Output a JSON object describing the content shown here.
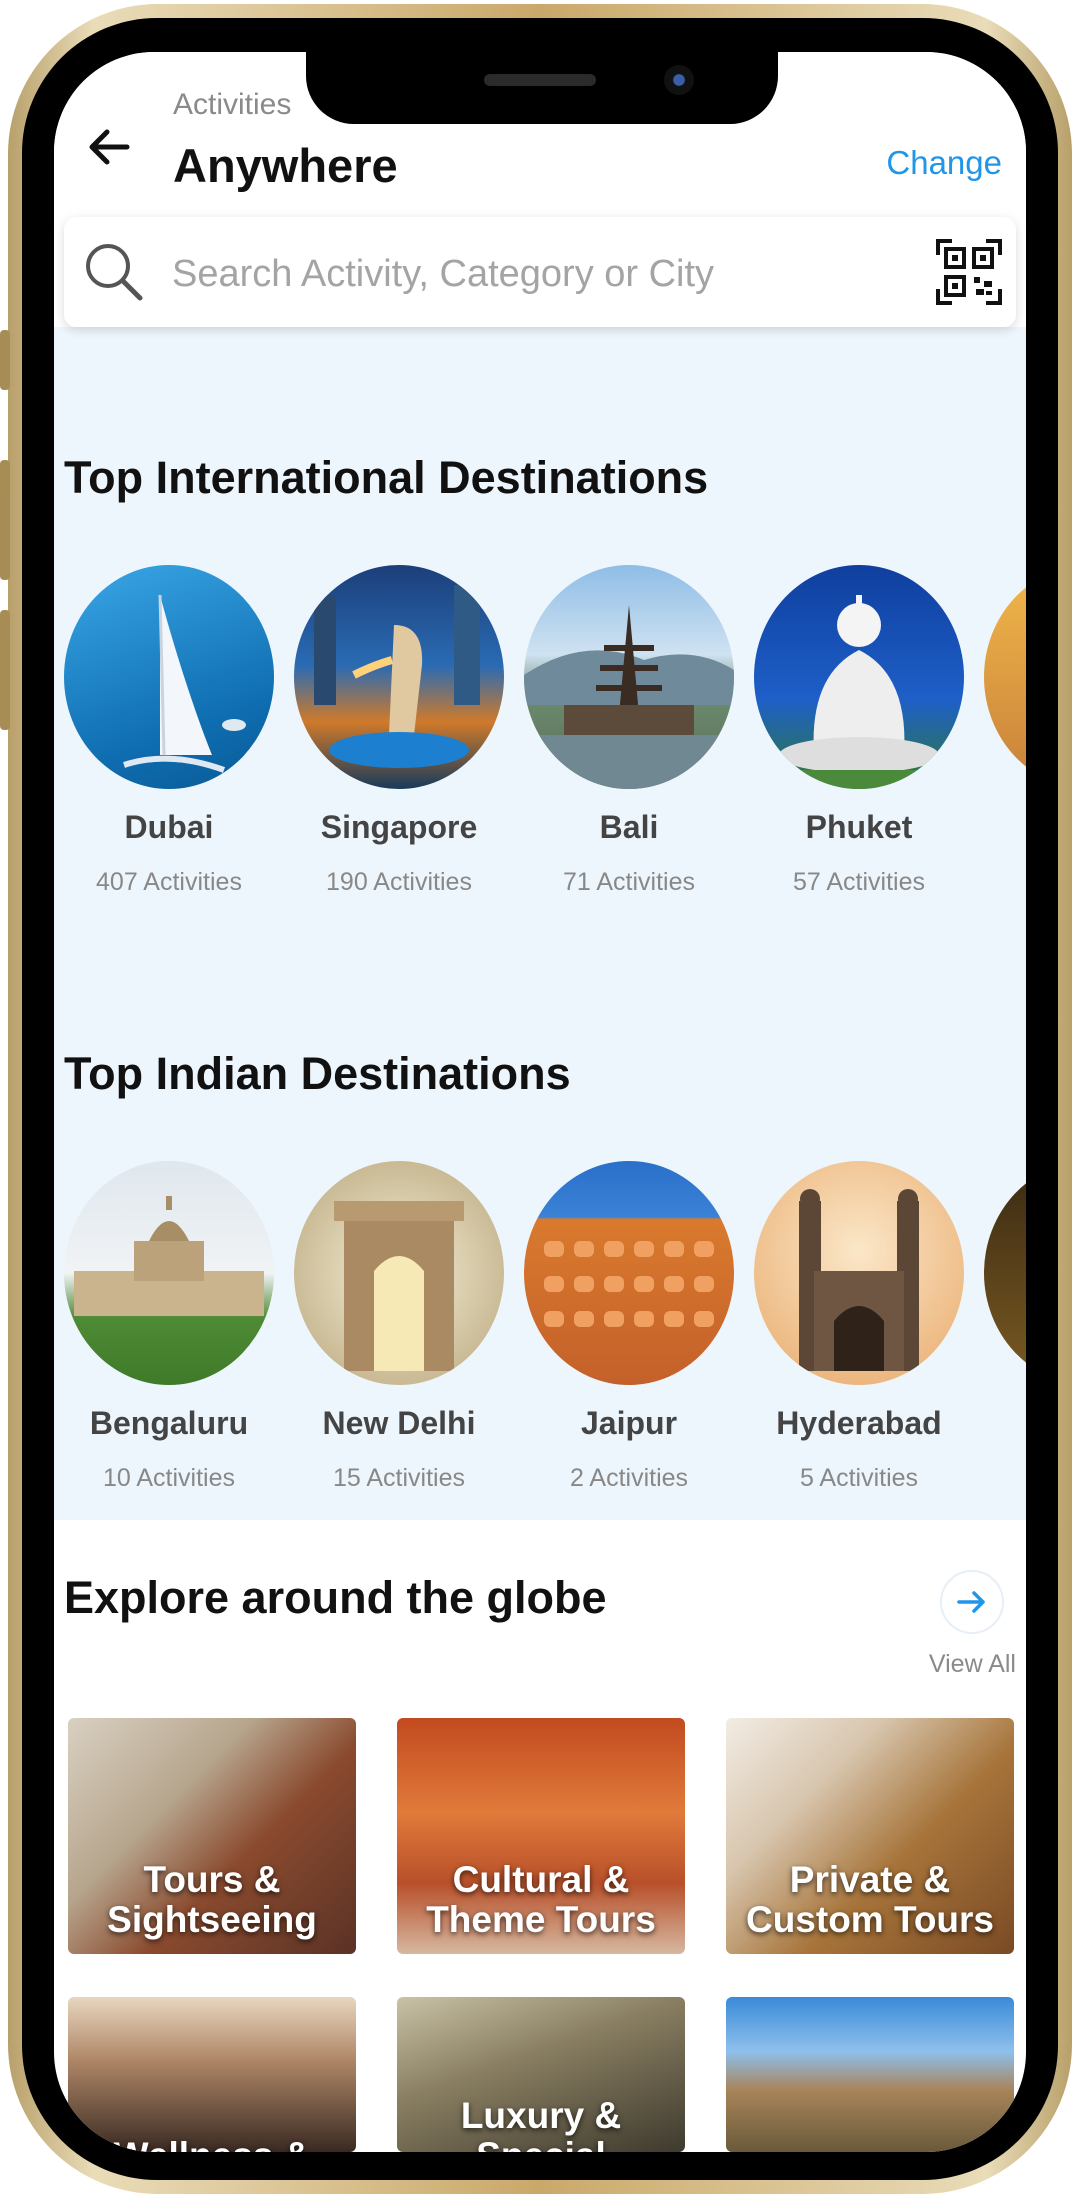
{
  "header": {
    "subtitle": "Activities",
    "title": "Anywhere",
    "change_label": "Change"
  },
  "search": {
    "placeholder": "Search Activity, Category or City"
  },
  "international": {
    "title": "Top International Destinations",
    "items": [
      {
        "name": "Dubai",
        "count": "407 Activities"
      },
      {
        "name": "Singapore",
        "count": "190 Activities"
      },
      {
        "name": "Bali",
        "count": "71 Activities"
      },
      {
        "name": "Phuket",
        "count": "57 Activities"
      }
    ]
  },
  "indian": {
    "title": "Top Indian Destinations",
    "items": [
      {
        "name": "Bengaluru",
        "count": "10 Activities"
      },
      {
        "name": "New Delhi",
        "count": "15 Activities"
      },
      {
        "name": "Jaipur",
        "count": "2 Activities"
      },
      {
        "name": "Hyderabad",
        "count": "5 Activities"
      }
    ]
  },
  "explore": {
    "title": "Explore around the globe",
    "view_all": "View All",
    "tiles": [
      {
        "line1": "Tours &",
        "line2": "Sightseeing"
      },
      {
        "line1": "Cultural &",
        "line2": "Theme Tours"
      },
      {
        "line1": "Private &",
        "line2": "Custom Tours"
      },
      {
        "line1": "Wellness &",
        "line2": ""
      },
      {
        "line1": "Luxury &",
        "line2": "Special"
      },
      {
        "line1": "",
        "line2": ""
      }
    ]
  },
  "colors": {
    "accent": "#2196e8",
    "section_bg": "#eef6fd"
  }
}
